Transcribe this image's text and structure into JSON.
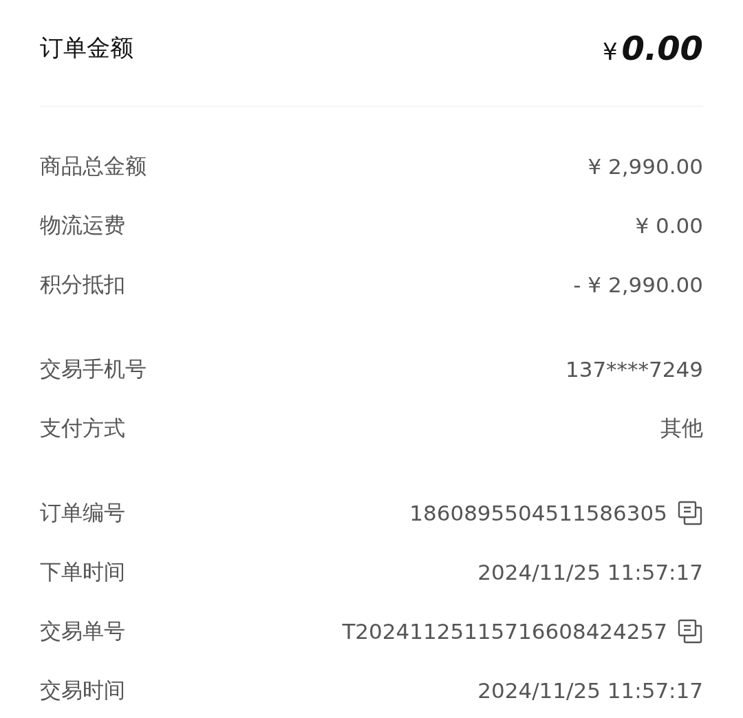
{
  "header": {
    "label": "订单金额",
    "currency": "¥",
    "amount": "0.00"
  },
  "groups": [
    {
      "rows": [
        {
          "label": "商品总金额",
          "value": "¥ 2,990.00",
          "kind": "plain"
        },
        {
          "label": "物流运费",
          "value": "¥ 0.00",
          "kind": "plain"
        },
        {
          "label": "积分抵扣",
          "value": "- ¥ 2,990.00",
          "kind": "plain"
        }
      ]
    },
    {
      "rows": [
        {
          "label": "交易手机号",
          "value": "137****7249",
          "kind": "plain"
        },
        {
          "label": "支付方式",
          "value": "其他",
          "kind": "plain"
        }
      ]
    },
    {
      "rows": [
        {
          "label": "订单编号",
          "value": "1860895504511586305",
          "kind": "copy"
        },
        {
          "label": "下单时间",
          "value": "2024/11/25 11:57:17",
          "kind": "plain"
        },
        {
          "label": "交易单号",
          "value": "T20241125115716608424257",
          "kind": "copy"
        },
        {
          "label": "交易时间",
          "value": "2024/11/25 11:57:17",
          "kind": "plain"
        }
      ]
    }
  ]
}
